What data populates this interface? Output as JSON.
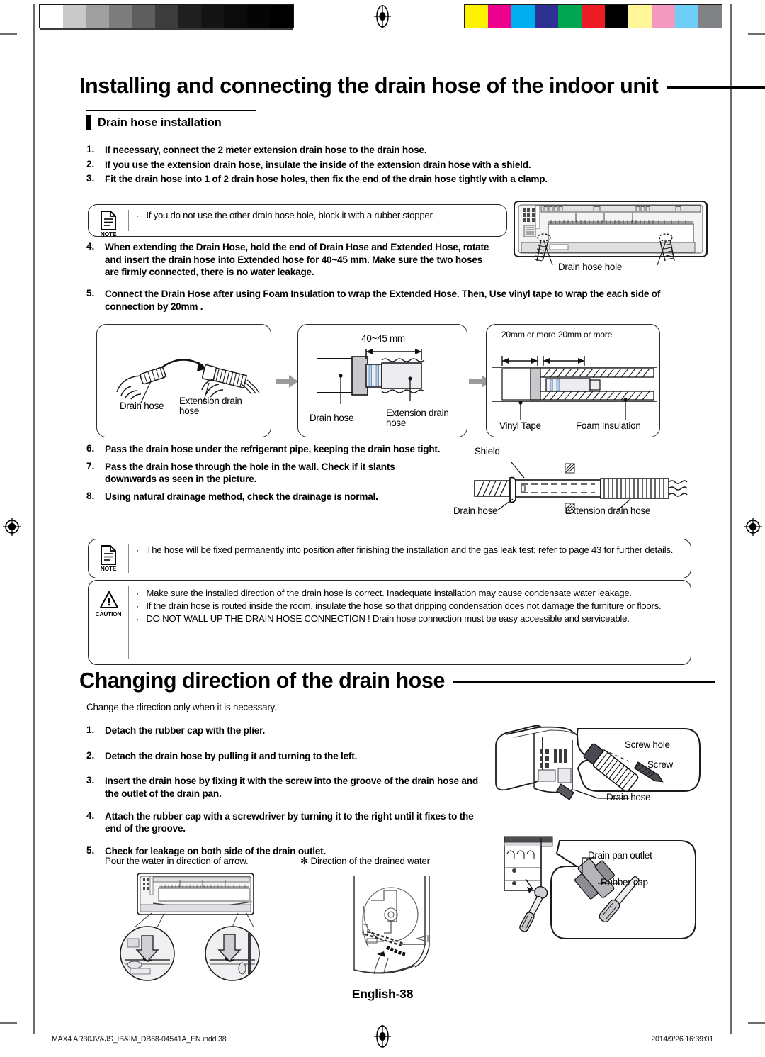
{
  "document": {
    "page_label": "English-38",
    "footer_file": "MAX4 AR30JV&JS_IB&IM_DB68-04541A_EN.indd   38",
    "footer_date": "2014/9/26   16:39:01"
  },
  "calibration": {
    "gray_scale": [
      "#000000",
      "#050505",
      "#0b0b0b",
      "#141414",
      "#1f1f1f",
      "#3c3c3c",
      "#5e5e5e",
      "#7d7d7d",
      "#a0a0a0",
      "#c9c9c9",
      "#ffffff"
    ],
    "color_scale": [
      "#fff200",
      "#ec008c",
      "#00aeef",
      "#2e3192",
      "#00a651",
      "#ed1c24",
      "#000000",
      "#fff799",
      "#f49ac1",
      "#6dcff6",
      "#808285"
    ]
  },
  "section1": {
    "title": "Installing and connecting the drain hose of the indoor unit",
    "subtitle": "Drain hose installation",
    "steps_a": [
      {
        "num": "1.",
        "text": "If necessary, connect the 2 meter extension drain hose to the drain hose."
      },
      {
        "num": "2.",
        "text": "If you use the extension drain hose, insulate the inside of the extension drain hose with a shield."
      },
      {
        "num": "3.",
        "text": "Fit the drain hose into 1 of 2 drain hose holes, then fix the end of the drain hose tightly with a clamp."
      }
    ],
    "note1": {
      "badge": "NOTE",
      "icon": "note-document-icon",
      "bullets": [
        "If you do not use the other drain hose hole, block it with a rubber stopper."
      ]
    },
    "steps_b": [
      {
        "num": "4.",
        "text": "When extending the Drain Hose, hold the end of Drain Hose and Extended Hose, rotate and insert the drain hose into  Extended hose for 40~45 mm. Make sure the two hoses are firmly connected, there is no water leakage."
      },
      {
        "num": "5.",
        "text": "Connect the Drain Hose after using Foam Insulation to wrap the Extended Hose. Then, Use vinyl tape to wrap the each side of connection by 20mm ."
      }
    ],
    "steps_c": [
      {
        "num": "6.",
        "text": "Pass the drain hose under the refrigerant pipe, keeping the drain hose tight."
      },
      {
        "num": "7.",
        "text": "Pass the drain hose through the hole in the wall. Check if it slants downwards as seen in the picture."
      },
      {
        "num": "8.",
        "text": "Using natural drainage method, check the drainage is normal."
      }
    ],
    "note2": {
      "badge": "NOTE",
      "icon": "note-document-icon",
      "bullets": [
        "The hose will be fixed permanently into position after finishing the installation and the gas leak test; refer to page 43 for further details."
      ]
    },
    "caution": {
      "badge": "CAUTION",
      "icon": "warning-triangle-icon",
      "bullets": [
        "Make sure the installed direction of the drain hose is correct. Inadequate installation may cause condensate water leakage.",
        "If the drain hose is routed inside the room, insulate the hose so that dripping condensation does not damage the furniture or floors.",
        "DO NOT WALL UP THE DRAIN HOSE CONNECTION ! Drain hose connection must be easy accessible and serviceable."
      ]
    },
    "unit_diagram": {
      "label": "Drain hose hole"
    },
    "panel1": {
      "labels": [
        "Drain hose",
        "Extension drain hose"
      ]
    },
    "panel2": {
      "dimension": "40~45 mm",
      "labels": [
        "Drain hose",
        "Extension drain hose"
      ]
    },
    "panel3": {
      "dim_left": "20mm or more",
      "dim_right": "20mm or more",
      "labels": [
        "Vinyl Tape",
        "Foam Insulation"
      ]
    },
    "shield_diagram": {
      "labels": [
        "Shield",
        "Drain hose",
        "Extension drain hose"
      ]
    }
  },
  "section2": {
    "title": "Changing direction of the drain hose",
    "intro": "Change the direction only when it is necessary.",
    "steps": [
      {
        "num": "1.",
        "text": "Detach the rubber cap with the plier."
      },
      {
        "num": "2.",
        "text": "Detach the drain hose by pulling it and turning to the left."
      },
      {
        "num": "3.",
        "text": "Insert the drain hose by fixing it with the screw into the groove of the drain hose and the outlet of the drain pan."
      },
      {
        "num": "4.",
        "text": "Attach the rubber cap with a screwdriver by turning it to the right until it fixes to the end of the groove."
      },
      {
        "num": "5.",
        "text": "Check for leakage on both side of the drain outlet."
      }
    ],
    "pour_note": "Pour the water in direction of arrow.",
    "direction_note": "✻ Direction of the drained water",
    "screw_callout": {
      "labels": [
        "Screw hole",
        "Screw",
        "Drain hose"
      ]
    },
    "cap_callout": {
      "labels": [
        "Drain pan outlet",
        "Rubber cap"
      ]
    }
  }
}
